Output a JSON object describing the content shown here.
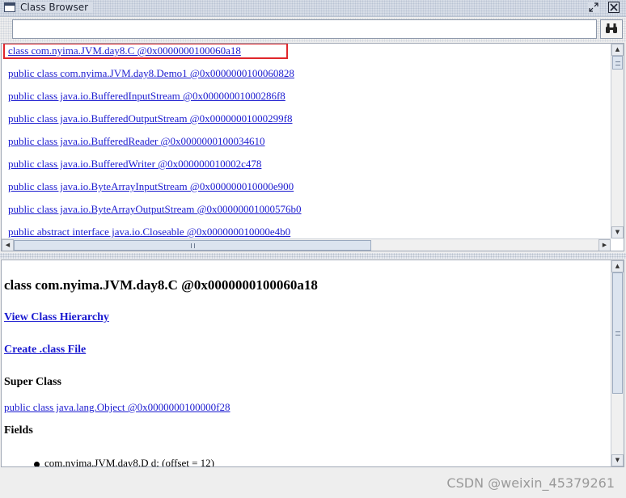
{
  "window": {
    "title": "Class Browser"
  },
  "search": {
    "value": "",
    "placeholder": ""
  },
  "class_list": {
    "items": [
      "class com.nyima.JVM.day8.C @0x0000000100060a18",
      "public class com.nyima.JVM.day8.Demo1 @0x0000000100060828",
      "public class java.io.BufferedInputStream @0x00000001000286f8",
      "public class java.io.BufferedOutputStream @0x00000001000299f8",
      "public class java.io.BufferedReader @0x0000000100034610",
      "public class java.io.BufferedWriter @0x000000010002c478",
      "public class java.io.ByteArrayInputStream @0x000000010000e900",
      "public class java.io.ByteArrayOutputStream @0x00000001000576b0",
      "public abstract interface java.io.Closeable @0x000000010000e4b0"
    ],
    "selected_index": 0
  },
  "detail": {
    "title": "class com.nyima.JVM.day8.C @0x0000000100060a18",
    "view_hierarchy_link": "View Class Hierarchy",
    "create_class_file_link": "Create .class File",
    "super_class_heading": "Super Class",
    "super_class_link": "public class java.lang.Object @0x0000000100000f28",
    "fields_heading": "Fields",
    "fields": [
      "com.nyima.JVM.day8.D d; (offset = 12)"
    ]
  },
  "watermark": "CSDN @weixin_45379261",
  "colors": {
    "link": "#1b1bd0",
    "selection_outline": "#e0262b",
    "titlebar": "#d7dde7"
  },
  "icons": {
    "search_button": "binoculars-icon",
    "restore_button": "restore-icon",
    "close_button": "close-icon"
  }
}
